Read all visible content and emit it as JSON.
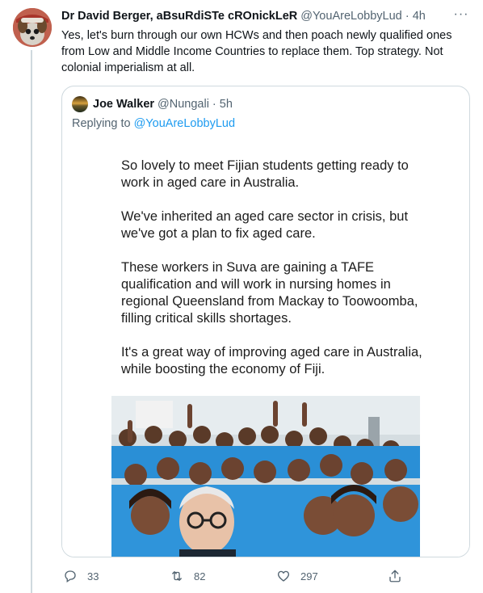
{
  "tweet": {
    "author_name": "Dr David Berger, aBsuRdiSTe cROnickLeR",
    "handle": "@YouAreLobbyLud",
    "separator": "·",
    "time": "4h",
    "more_icon": "···",
    "text": "Yes, let's burn through our own HCWs and then poach newly qualified ones from Low and Middle Income Countries to replace them. Top strategy. Not colonial imperialism at all."
  },
  "quote": {
    "author_name": "Joe Walker",
    "handle": "@Nungali",
    "separator": "·",
    "time": "5h",
    "replying_prefix": "Replying to",
    "replying_to": "@YouAreLobbyLud",
    "image_paragraphs": [
      "So lovely to meet Fijian students getting ready to work in aged care in Australia.",
      "We've inherited an aged care sector in crisis, but we've got a plan to fix aged care.",
      "These workers in Suva are gaining a TAFE qualification and will work in nursing homes in regional Queensland from Mackay to Toowoomba, filling critical skills shortages.",
      "It's a great way of improving aged care in Australia, while boosting the economy of Fiji."
    ]
  },
  "actions": {
    "reply_count": "33",
    "retweet_count": "82",
    "like_count": "297"
  },
  "colors": {
    "text": "#0f1419",
    "muted": "#536471",
    "link": "#1d9bf0",
    "border": "#cfd9de",
    "uniform_blue": "#2a8fd6"
  }
}
